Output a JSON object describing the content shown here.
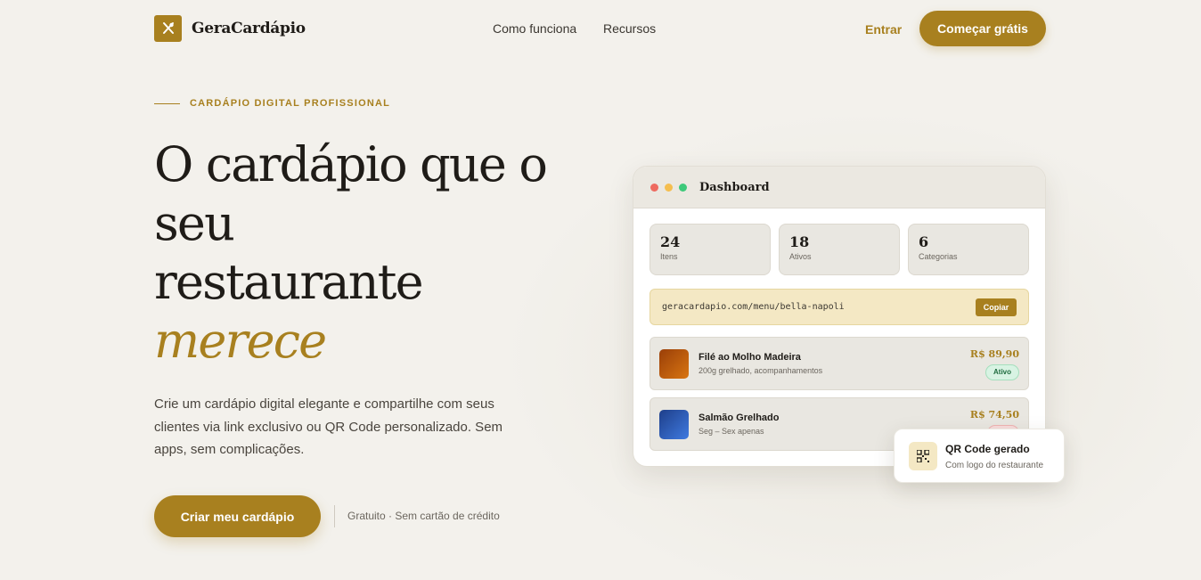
{
  "brand": {
    "name": "GeraCardápio",
    "accent_color": "#a8801f",
    "logo_icon": "utensils-icon"
  },
  "nav": {
    "links": [
      "Como funciona",
      "Recursos"
    ],
    "login_label": "Entrar",
    "cta_label": "Começar grátis"
  },
  "hero": {
    "eyebrow": "CARDÁPIO DIGITAL PROFISSIONAL",
    "headline_line1": "O cardápio que o",
    "headline_line2": "seu",
    "headline_line3": "restaurante",
    "headline_accent": "merece",
    "subtitle": "Crie um cardápio digital elegante e compartilhe com seus clientes via link exclusivo ou QR Code personalizado. Sem apps, sem complicações.",
    "cta_label": "Criar meu cardápio",
    "note": "Gratuito · Sem cartão de crédito"
  },
  "dashboard": {
    "title": "Dashboard",
    "window_dots": [
      "#ee6a5f",
      "#f5be4f",
      "#3ec97a"
    ],
    "stats": [
      {
        "value": "24",
        "label": "Itens"
      },
      {
        "value": "18",
        "label": "Ativos"
      },
      {
        "value": "6",
        "label": "Categorias"
      }
    ],
    "link": {
      "url": "geracardapio.com/menu/bella-napoli",
      "copy_label": "Copiar"
    },
    "items": [
      {
        "name": "Filé ao Molho Madeira",
        "desc": "200g grelhado, acompanhamentos",
        "price": "R$ 89,90",
        "status": "Ativo",
        "thumb_color": "#b8560d"
      },
      {
        "name": "Salmão Grelhado",
        "desc": "Seg – Sex apenas",
        "price": "R$ 74,50",
        "status": "",
        "thumb_color": "#2b5db8"
      }
    ]
  },
  "toast": {
    "icon": "qr-code-icon",
    "title": "QR Code gerado",
    "subtitle": "Com logo do restaurante"
  }
}
